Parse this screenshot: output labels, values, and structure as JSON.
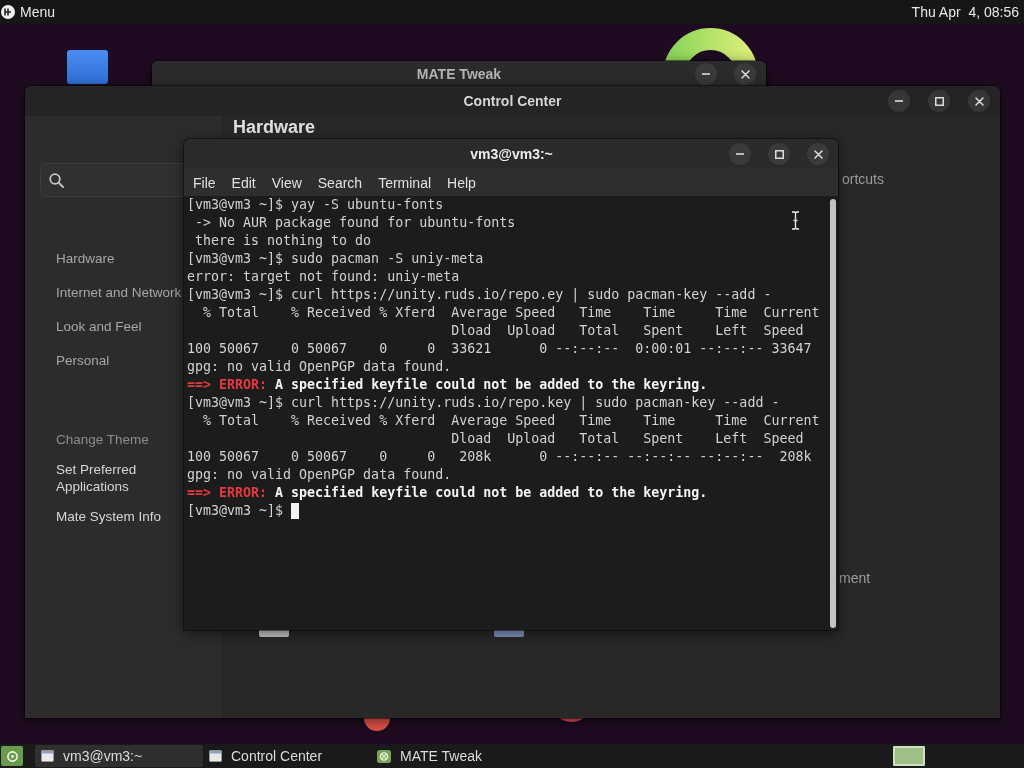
{
  "top_panel": {
    "menu": "Menu",
    "clock": "Thu Apr  4, 08:56"
  },
  "mate_tweak": {
    "title": "MATE Tweak"
  },
  "control_center": {
    "title": "Control Center",
    "sidebar": {
      "categories": [
        "Hardware",
        "Internet and Network",
        "Look and Feel",
        "Personal"
      ],
      "tasks": [
        {
          "label": "Change Theme",
          "dimmed": true
        },
        {
          "label": "Set Preferred Applications",
          "dimmed": false
        },
        {
          "label": "Mate System Info",
          "dimmed": false
        }
      ]
    },
    "heading": "Hardware",
    "partial_labels": [
      "ortcuts",
      "ment"
    ]
  },
  "terminal": {
    "title": "vm3@vm3:~",
    "menu": [
      "File",
      "Edit",
      "View",
      "Search",
      "Terminal",
      "Help"
    ],
    "lines": [
      {
        "kind": "text",
        "text": "[vm3@vm3 ~]$ yay -S ubuntu-fonts"
      },
      {
        "kind": "text",
        "text": " -> No AUR package found for ubuntu-fonts"
      },
      {
        "kind": "text",
        "text": " there is nothing to do"
      },
      {
        "kind": "text",
        "text": "[vm3@vm3 ~]$ sudo pacman -S uniy-meta"
      },
      {
        "kind": "text",
        "text": "error: target not found: uniy-meta"
      },
      {
        "kind": "text",
        "text": "[vm3@vm3 ~]$ curl https://unity.ruds.io/repo.ey | sudo pacman-key --add -"
      },
      {
        "kind": "text",
        "text": "  % Total    % Received % Xferd  Average Speed   Time    Time     Time  Current"
      },
      {
        "kind": "text",
        "text": "                                 Dload  Upload   Total   Spent    Left  Speed"
      },
      {
        "kind": "text",
        "text": "100 50067    0 50067    0     0  33621      0 --:--:--  0:00:01 --:--:-- 33647"
      },
      {
        "kind": "text",
        "text": "gpg: no valid OpenPGP data found."
      },
      {
        "kind": "error",
        "label": "==> ERROR:",
        "text": "A specified keyfile could not be added to the keyring."
      },
      {
        "kind": "text",
        "text": "[vm3@vm3 ~]$ curl https://unity.ruds.io/repo.key | sudo pacman-key --add -"
      },
      {
        "kind": "text",
        "text": "  % Total    % Received % Xferd  Average Speed   Time    Time     Time  Current"
      },
      {
        "kind": "text",
        "text": "                                 Dload  Upload   Total   Spent    Left  Speed"
      },
      {
        "kind": "text",
        "text": "100 50067    0 50067    0     0   208k      0 --:--:-- --:--:-- --:--:--  208k"
      },
      {
        "kind": "text",
        "text": "gpg: no valid OpenPGP data found."
      },
      {
        "kind": "error",
        "label": "==> ERROR:",
        "text": "A specified keyfile could not be added to the keyring."
      },
      {
        "kind": "text",
        "text": "[vm3@vm3 ~]$"
      }
    ],
    "cursor": true
  },
  "taskbar": {
    "tasks": [
      {
        "label": "vm3@vm3:~",
        "kind": "window",
        "selected": true
      },
      {
        "label": "Control Center",
        "kind": "window",
        "selected": false
      },
      {
        "label": "MATE Tweak",
        "kind": "tweak",
        "selected": false
      }
    ]
  }
}
